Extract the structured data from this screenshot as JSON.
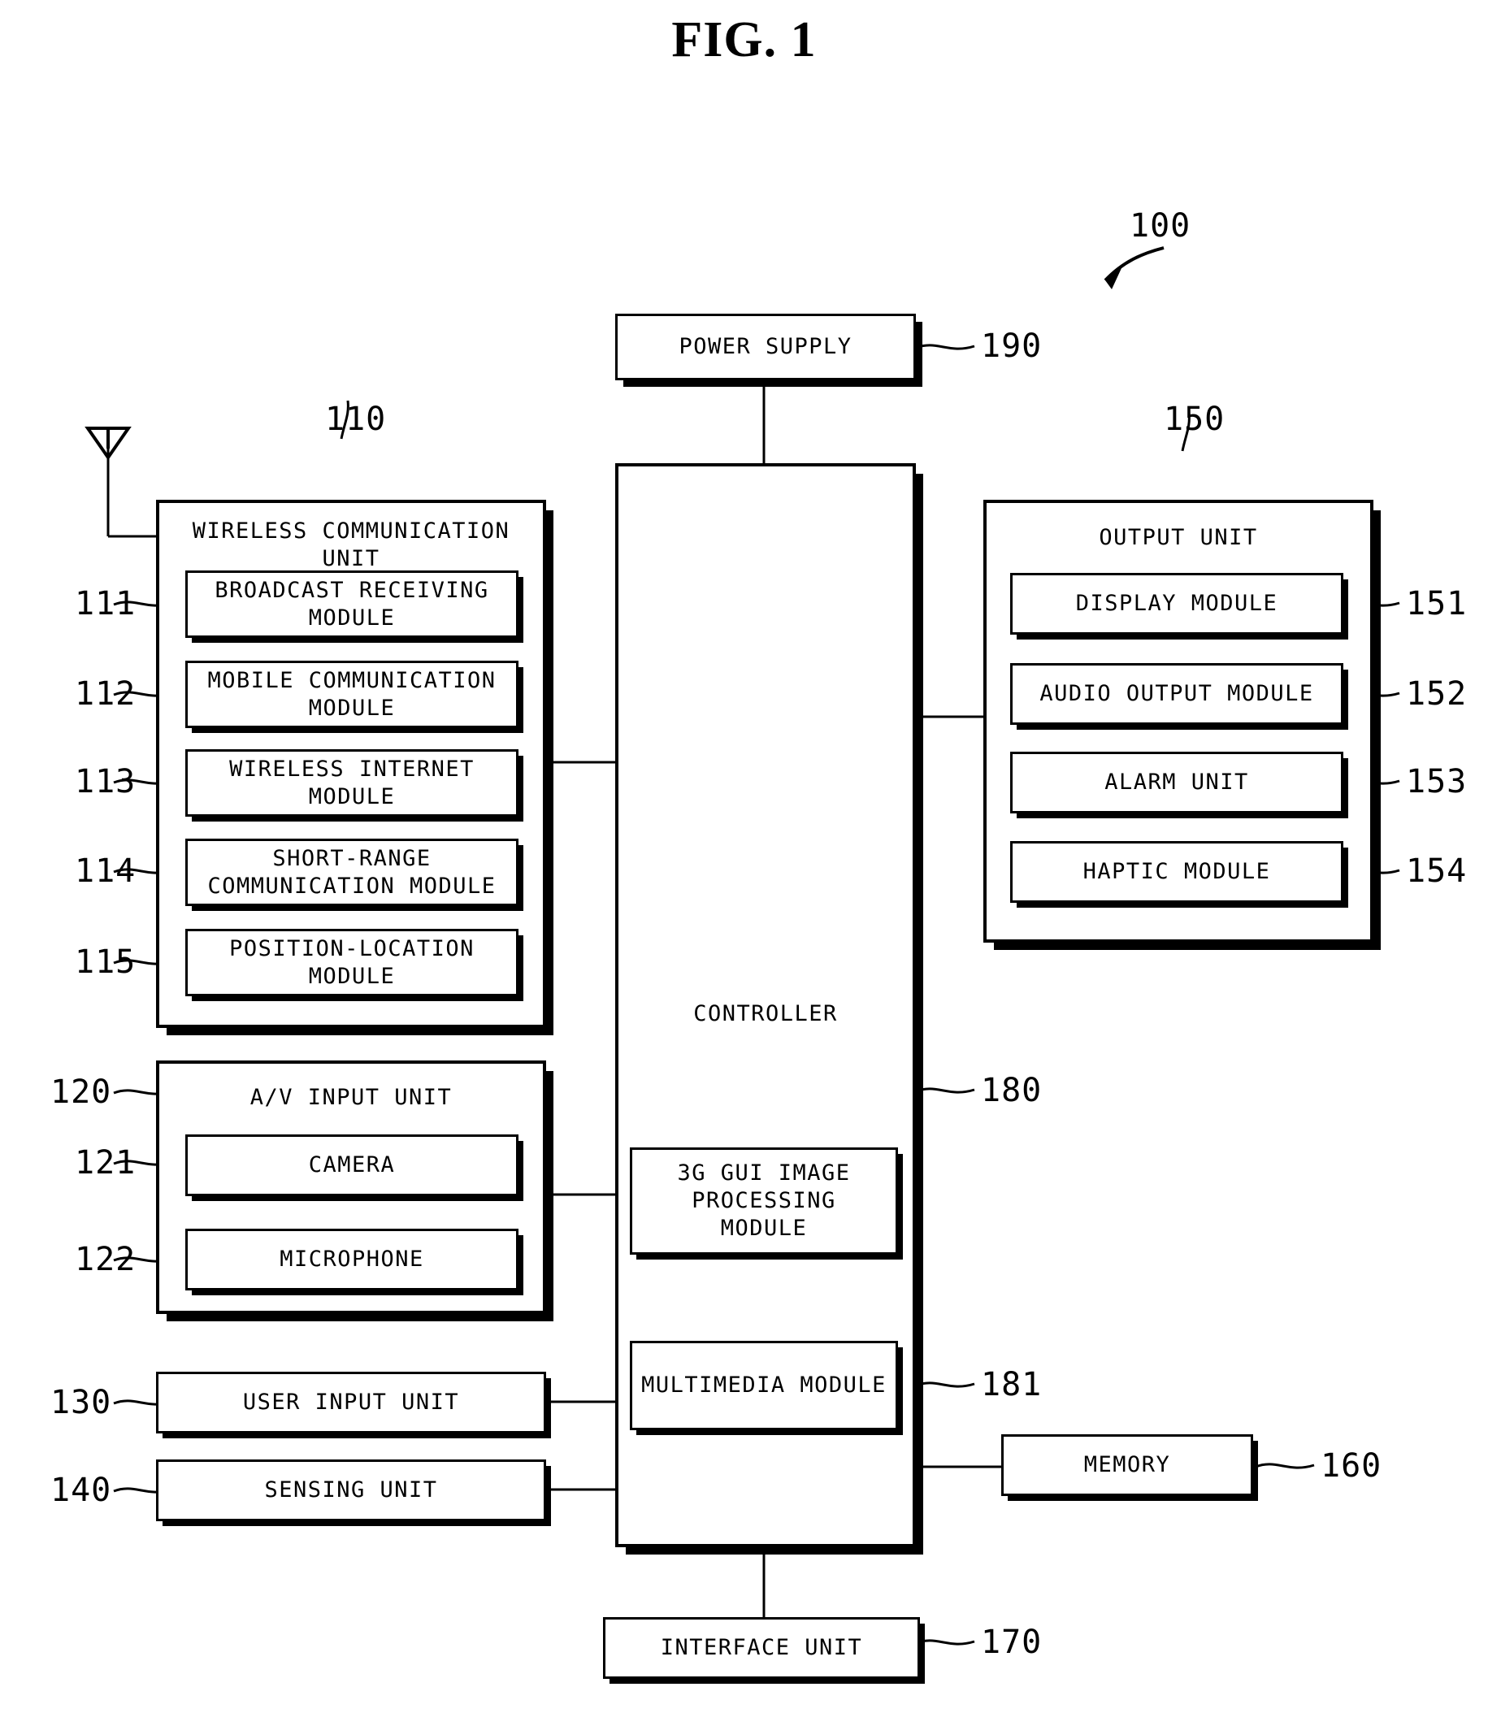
{
  "figure": {
    "title": "FIG. 1",
    "device_ref": "100"
  },
  "power_supply": {
    "label": "POWER SUPPLY",
    "ref": "190"
  },
  "controller": {
    "label": "CONTROLLER",
    "ref": "180",
    "modules": [
      {
        "label": "3G GUI IMAGE\nPROCESSING\nMODULE",
        "ref": ""
      },
      {
        "label": "MULTIMEDIA MODULE",
        "ref": "181"
      }
    ]
  },
  "wireless_communication_unit": {
    "label": "WIRELESS COMMUNICATION\nUNIT",
    "ref": "110",
    "modules": [
      {
        "label": "BROADCAST RECEIVING\nMODULE",
        "ref": "111"
      },
      {
        "label": "MOBILE COMMUNICATION\nMODULE",
        "ref": "112"
      },
      {
        "label": "WIRELESS INTERNET\nMODULE",
        "ref": "113"
      },
      {
        "label": "SHORT-RANGE\nCOMMUNICATION MODULE",
        "ref": "114"
      },
      {
        "label": "POSITION-LOCATION\nMODULE",
        "ref": "115"
      }
    ]
  },
  "av_input_unit": {
    "label": "A/V INPUT UNIT",
    "ref": "120",
    "modules": [
      {
        "label": "CAMERA",
        "ref": "121"
      },
      {
        "label": "MICROPHONE",
        "ref": "122"
      }
    ]
  },
  "user_input_unit": {
    "label": "USER INPUT UNIT",
    "ref": "130"
  },
  "sensing_unit": {
    "label": "SENSING UNIT",
    "ref": "140"
  },
  "output_unit": {
    "label": "OUTPUT UNIT",
    "ref": "150",
    "modules": [
      {
        "label": "DISPLAY MODULE",
        "ref": "151"
      },
      {
        "label": "AUDIO OUTPUT MODULE",
        "ref": "152"
      },
      {
        "label": "ALARM UNIT",
        "ref": "153"
      },
      {
        "label": "HAPTIC MODULE",
        "ref": "154"
      }
    ]
  },
  "memory": {
    "label": "MEMORY",
    "ref": "160"
  },
  "interface_unit": {
    "label": "INTERFACE UNIT",
    "ref": "170"
  },
  "icons": {
    "antenna": "antenna-icon",
    "device_arrow": "curved-arrow-icon"
  },
  "colors": {
    "ink": "#000000",
    "paper": "#ffffff"
  }
}
